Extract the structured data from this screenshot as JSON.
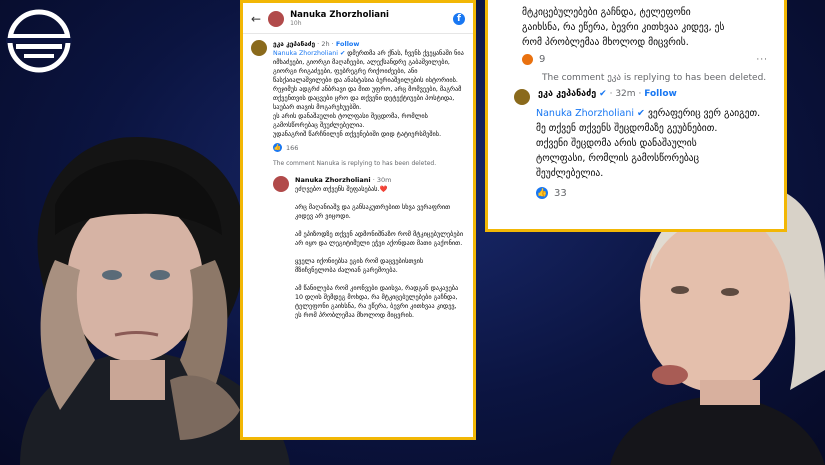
{
  "header": {
    "author": "Nanuka Zhorzholiani",
    "time": "10h"
  },
  "comment1": {
    "author": "ეკა კეპანაძე",
    "time": "2h",
    "follow": "Follow",
    "mention": "Nanuka Zhorzholiani",
    "text": " დმერთმა არ ქნას, ჩვენს ქვეყანაში ნია იმხაძეები, გიორგი მაღაჩეები, ალექსანდრე გაბაშვილები, გიორგი რიგაძეები, ფებრეგრე რიქოიძეები, ანი წასქაიალაშვილები და ანასტასია ბერიაშვილების ისტორიის.\nრეჯიმუს ადგრძ ანბრავი და მით უფრო, არც მომვეები, მაგრამ თქვენთვის დაცვები ცრო და თქვენი დეტექტიუები პოსტიდა, საუბარ თავის მოგარეხუებში.\nეს არის დანაშაულის ტოლფასი შეცდომა, რომლის გამოსწორებაც შეუძლებელია.\nუდანაგრიშ წარჩნილენ თქვენებიში დიდ ტატიერსმეშის.",
    "likes": "166"
  },
  "deleted_note": "The comment Nanuka is replying to has been deleted.",
  "reply1": {
    "author": "Nanuka Zhorzholiani",
    "time": "30m",
    "text": "ეძღვებო თქვენს შეფასებას.❤️\n\nარც მაღანიაშვ და განსაკუთრებით სხვა ვერაფრით კიდევ არ ვიცოდი.\n\nამ ეპიზოდზე თქვენ ადმონიშნაზო რომ მტკიცებულებები არ იყო და ლეგიტიმული ეჭვი აქონდათ მათი გაქონით.\n\nყველა იქონიებსა ეგის რომ დაცვებისთვის მზიჩვნელობა ძალიან გარემოება.\n\nამ წანილება რომ კიონვები დაისვა, რადგან დაკავება 10 დღის შემდეგ მოხდა, რა მტკიცებულებები გაჩნდა, ტელეფონი გაიხსნა, რა ეწერა, ბევრი კითხვაა კიდევ, ეს რომ პრობლემაა მხოლოდ მიცვრის."
  },
  "right": {
    "top_text": "მტკიცებულებები გაჩნდა, ტელეფონი\nგაიხსნა, რა ეწერა, ბევრი კითხვაა კიდევ, ეს\nრომ პრობლემაა მხოლოდ მიცვრის.",
    "top_reactions": "9",
    "deleted_note": "The comment ეკა is replying to has been deleted.",
    "author": "ეკა კეპანაძე",
    "time": "32m",
    "follow": "Follow",
    "mention": "Nanuka Zhorzholiani",
    "text": " ვერაფერიც ვერ გაიგეთ.\nმე თქვენ თქვენს შეცდომაზე გეუბნებით.\nთქვენი შეცდომა არის დანაშაულის\nტოლფასი,  რომლის გამოსწორებაც\nშეუძლებელია.",
    "likes": "33"
  }
}
